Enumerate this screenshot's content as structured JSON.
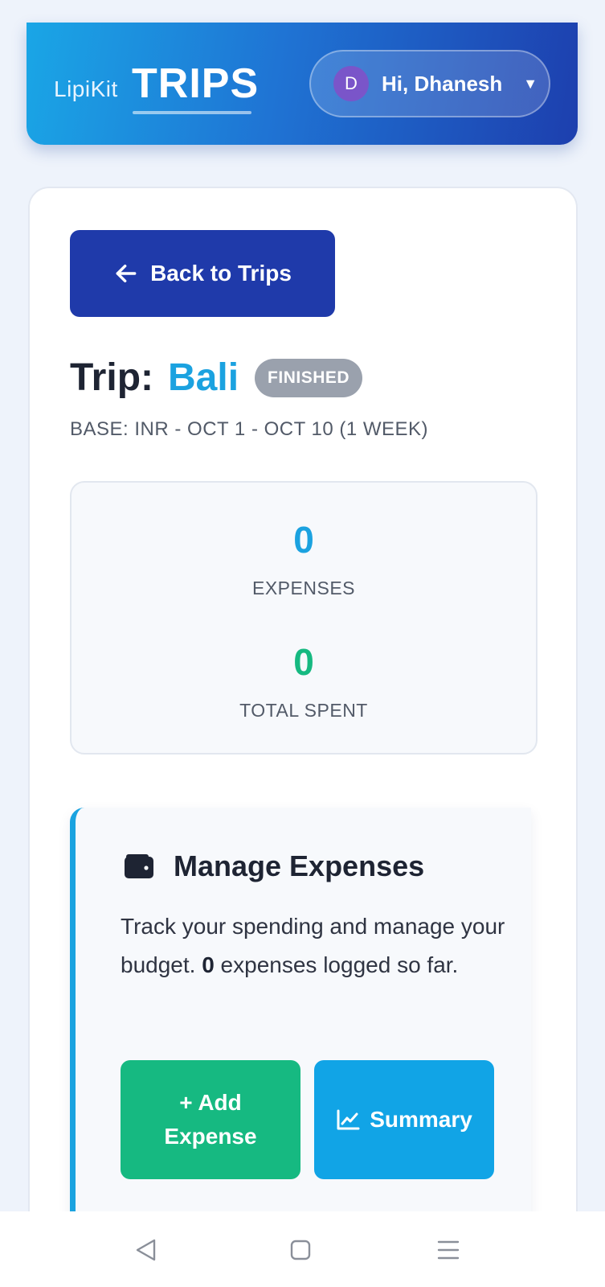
{
  "header": {
    "brand_small": "LipiKit",
    "brand_big": "TRIPS",
    "user_initial": "D",
    "greeting": "Hi, Dhanesh",
    "caret": "▼"
  },
  "trip": {
    "back_label": "Back to Trips",
    "title_prefix": "Trip:",
    "name": "Bali",
    "status": "FINISHED",
    "meta": "BASE: INR - OCT 1 - OCT 10 (1 WEEK)"
  },
  "stats": {
    "expenses_value": "0",
    "expenses_label": "EXPENSES",
    "total_value": "0",
    "total_label": "TOTAL SPENT"
  },
  "manage": {
    "icon": "wallet-icon",
    "title": "Manage Expenses",
    "desc_before": "Track your spending and manage your budget. ",
    "desc_count": "0",
    "desc_after": " expenses logged so far.",
    "add_label": "+ Add Expense",
    "summary_label": "Summary",
    "summary_icon": "chart-line-icon"
  },
  "navbar": {
    "back_icon": "nav-back-icon",
    "home_icon": "nav-home-icon",
    "menu_icon": "nav-menu-icon"
  },
  "colors": {
    "accent_blue": "#1ba2e0",
    "primary_dark": "#1f3aaa",
    "success_green": "#16b981",
    "badge_gray": "#9aa1ad"
  }
}
